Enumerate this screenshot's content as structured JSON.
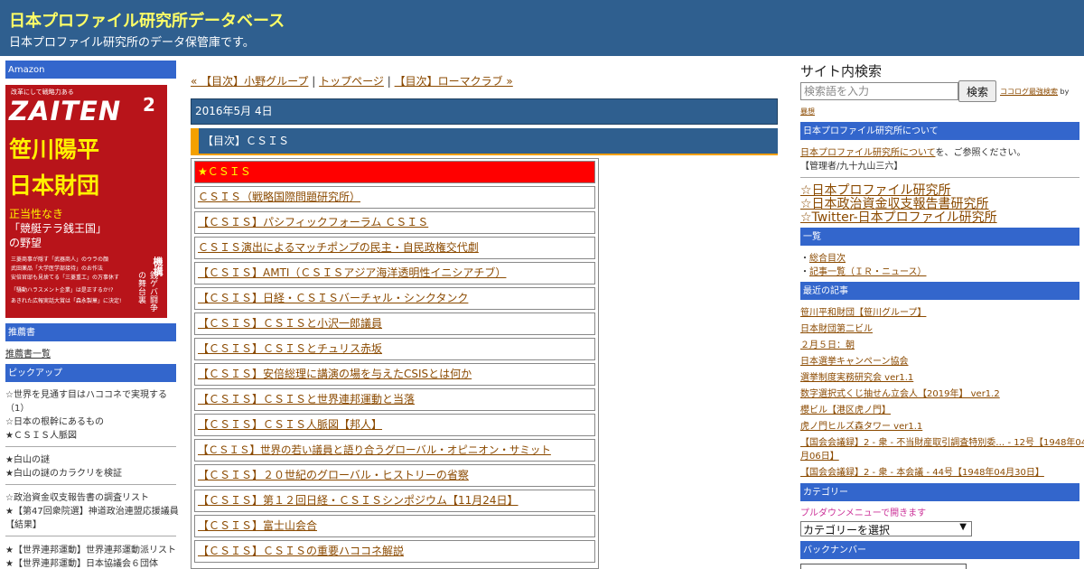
{
  "header": {
    "site_title": "日本プロファイル研究所データベース",
    "site_description": "日本プロファイル研究所のデータ保管庫です。"
  },
  "left": {
    "amazon_heading": "Amazon",
    "ad": {
      "top_line": "改革にして戦略力ある",
      "logo": "ZAITEN",
      "issue": "2",
      "headline_1": "笹川陽平",
      "headline_2": "日本財団",
      "sub_1": "正当性なき",
      "sub_2": "「競艇テラ銭王国」",
      "sub_3": "の野望",
      "side_1": "産業革新投資機構",
      "side_2": "銭ゲバ闘争の舞台裏",
      "lines": [
        "三菱商事が隠す「武器商人」のウラの顔",
        "武田薬品「大学医学部接待」のお作法",
        "安倍官邸も見捨てる「三菱重工」の万事休す",
        "「騒動ハラスメント企業」は是正するか!?",
        "あきれた広報実話大賞は「森永製菓」に決定!"
      ]
    },
    "recommend_heading": "推薦書",
    "recommend_link": "推薦書一覧",
    "pickup_heading": "ピックアップ",
    "pickup_group1": [
      "☆世界を見通す目はハココネで実現する",
      "（1）",
      "☆日本の根幹にあるもの",
      "★ＣＳＩＳ人脈図"
    ],
    "pickup_group2": [
      "★白山の謎",
      "★白山の謎のカラクリを検証"
    ],
    "pickup_group3": [
      "☆政治資金収支報告書の調査リスト",
      "★【第47回衆院選】神道政治連盟応援議員",
      "【結果】"
    ],
    "pickup_group4": [
      "★【世界連邦運動】世界連邦運動派リスト",
      "★【世界連邦運動】日本協議会６団体"
    ]
  },
  "main": {
    "nav_prev": "« 【目次】小野グループ",
    "nav_sep": "|",
    "nav_top": "トップページ",
    "nav_next": "【目次】ローマクラブ »",
    "date": "2016年5月 4日",
    "entry_title": "【目次】ＣＳＩＳ",
    "list": [
      "★ＣＳＩＳ",
      "ＣＳＩＳ（戦略国際問題研究所）",
      "【ＣＳＩＳ】パシフィックフォーラム ＣＳＩＳ",
      "ＣＳＩＳ演出によるマッチポンプの民主・自民政権交代劇",
      "【ＣＳＩＳ】AMTI（ＣＳＩＳアジア海洋透明性イニシアチブ）",
      "【ＣＳＩＳ】日経・ＣＳＩＳバーチャル・シンクタンク",
      "【ＣＳＩＳ】ＣＳＩＳと小沢一郎議員",
      "【ＣＳＩＳ】ＣＳＩＳとチュリス赤坂",
      "【ＣＳＩＳ】安倍総理に講演の場を与えたCSISとは何か",
      "【ＣＳＩＳ】ＣＳＩＳと世界連邦運動と当落",
      "【ＣＳＩＳ】ＣＳＩＳ人脈図【邦人】",
      "【ＣＳＩＳ】世界の若い議員と語り合うグローバル・オピニオン・サミット",
      "【ＣＳＩＳ】２０世紀のグローバル・ヒストリーの省察",
      "【ＣＳＩＳ】第１２回日経・ＣＳＩＳシンポジウム【11月24日】",
      "【ＣＳＩＳ】富士山会合",
      "【ＣＳＩＳ】ＣＳＩＳの重要ハココネ解説"
    ]
  },
  "right": {
    "search_title": "サイト内検索",
    "search_placeholder": "検索語を入力",
    "search_button": "検索",
    "search_credit": "ココログ最強検索",
    "search_credit_by": "by",
    "search_credit_author": "暴想",
    "about_heading": "日本プロファイル研究所について",
    "about_link": "日本プロファイル研究所について",
    "about_text": "を、ご参照ください。",
    "admin": "【管理者/九十九山三六】",
    "big_links": [
      "☆日本プロファイル研究所",
      "☆日本政治資金収支報告書研究所",
      "☆Twitter-日本プロファイル研究所"
    ],
    "list_heading": "一覧",
    "list_items": [
      "総合目次",
      "記事一覧（ＩＲ・ニュース）"
    ],
    "recent_heading": "最近の記事",
    "recent": [
      "笹川平和財団【笹川グループ】",
      "日本財団第二ビル",
      "２月５日：朝",
      "日本選挙キャンペーン協会",
      "選挙制度実務研究会 ver1.1",
      "数字選択式くじ抽せん立会人【2019年】 ver1.2",
      "櫻ビル【港区虎ノ門】",
      "虎ノ門ヒルズ森タワー ver1.1",
      "【国会会議録】2 - 衆 - 不当財産取引調査特別委… - 12号【1948年04",
      "月06日】",
      "【国会会議録】2 - 衆 - 本会議 - 44号【1948年04月30日】"
    ],
    "category_heading": "カテゴリー",
    "category_note": "プルダウンメニューで開きます",
    "category_select": "カテゴリーを選択",
    "backnumber_heading": "バックナンバー"
  }
}
